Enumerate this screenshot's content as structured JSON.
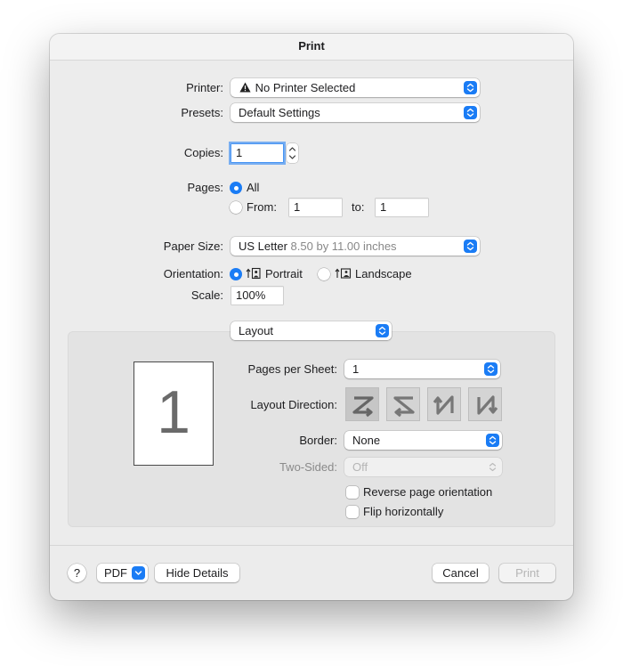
{
  "window": {
    "title": "Print"
  },
  "printer": {
    "label": "Printer:",
    "value": "No Printer Selected",
    "warning_icon": "warning-icon"
  },
  "presets": {
    "label": "Presets:",
    "value": "Default Settings"
  },
  "copies": {
    "label": "Copies:",
    "value": "1"
  },
  "pages": {
    "label": "Pages:",
    "all_label": "All",
    "from_label": "From:",
    "from_value": "1",
    "to_label": "to:",
    "to_value": "1",
    "selected": "All"
  },
  "paper_size": {
    "label": "Paper Size:",
    "value": "US Letter",
    "detail": "8.50 by 11.00 inches"
  },
  "orientation": {
    "label": "Orientation:",
    "portrait_label": "Portrait",
    "landscape_label": "Landscape",
    "selected": "Portrait"
  },
  "scale": {
    "label": "Scale:",
    "value": "100%"
  },
  "section_menu": {
    "value": "Layout"
  },
  "layout": {
    "preview_number": "1",
    "pages_per_sheet_label": "Pages per Sheet:",
    "pages_per_sheet_value": "1",
    "layout_direction_label": "Layout Direction:",
    "directions": [
      "left-to-right-z",
      "right-to-left-z",
      "top-to-bottom-n-reverse",
      "top-to-bottom-n"
    ],
    "selected_direction": "left-to-right-z",
    "border_label": "Border:",
    "border_value": "None",
    "two_sided_label": "Two-Sided:",
    "two_sided_value": "Off",
    "reverse_label": "Reverse page orientation",
    "flip_label": "Flip horizontally"
  },
  "footer": {
    "help_label": "?",
    "pdf_label": "PDF",
    "hide_details_label": "Hide Details",
    "cancel_label": "Cancel",
    "print_label": "Print"
  },
  "colors": {
    "accent": "#1a7cf5",
    "window_bg": "#ececec",
    "panel_bg": "#e3e3e3"
  }
}
